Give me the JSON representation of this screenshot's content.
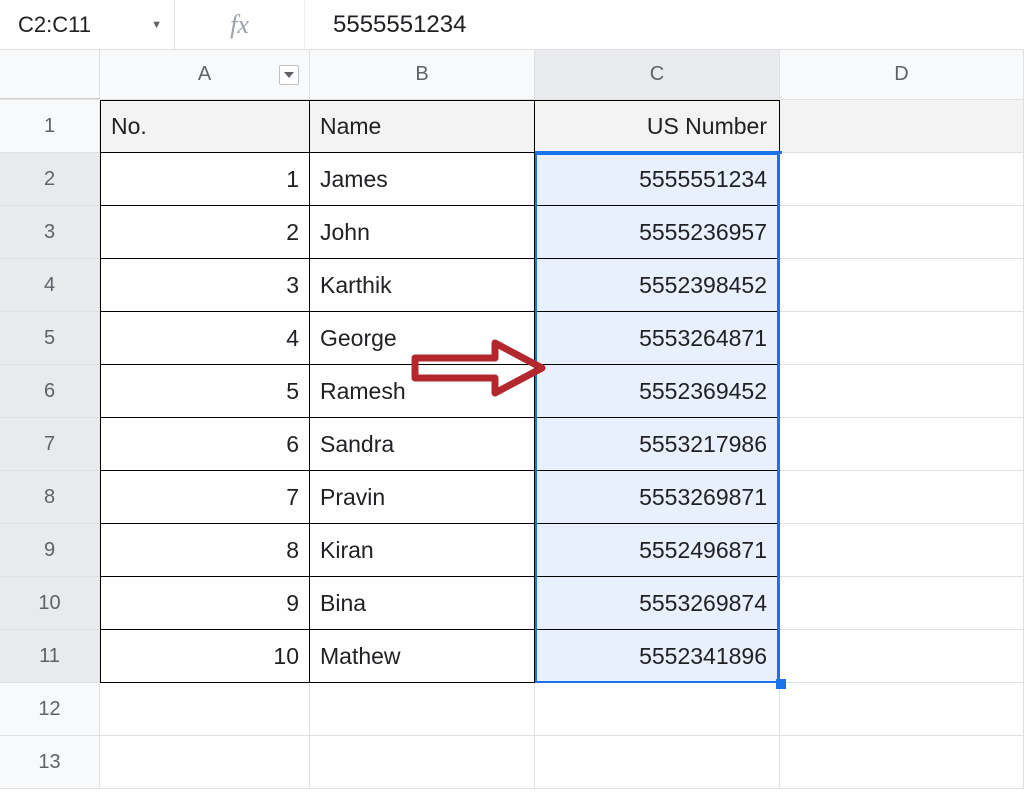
{
  "formula_bar": {
    "name_box": "C2:C11",
    "fx_label": "fx",
    "value": "5555551234"
  },
  "columns": {
    "A": "A",
    "B": "B",
    "C": "C",
    "D": "D"
  },
  "row_headers": [
    "1",
    "2",
    "3",
    "4",
    "5",
    "6",
    "7",
    "8",
    "9",
    "10",
    "11",
    "12",
    "13"
  ],
  "headers": {
    "no": "No.",
    "name": "Name",
    "usnumber": "US Number"
  },
  "rows": [
    {
      "no": "1",
      "name": "James",
      "num": "5555551234"
    },
    {
      "no": "2",
      "name": "John",
      "num": "5555236957"
    },
    {
      "no": "3",
      "name": "Karthik",
      "num": "5552398452"
    },
    {
      "no": "4",
      "name": "George",
      "num": "5553264871"
    },
    {
      "no": "5",
      "name": "Ramesh",
      "num": "5552369452"
    },
    {
      "no": "6",
      "name": "Sandra",
      "num": "5553217986"
    },
    {
      "no": "7",
      "name": "Pravin",
      "num": "5553269871"
    },
    {
      "no": "8",
      "name": "Kiran",
      "num": "5552496871"
    },
    {
      "no": "9",
      "name": "Bina",
      "num": "5553269874"
    },
    {
      "no": "10",
      "name": "Mathew",
      "num": "5552341896"
    }
  ],
  "annotation": {
    "arrow_color": "#b3282d"
  }
}
